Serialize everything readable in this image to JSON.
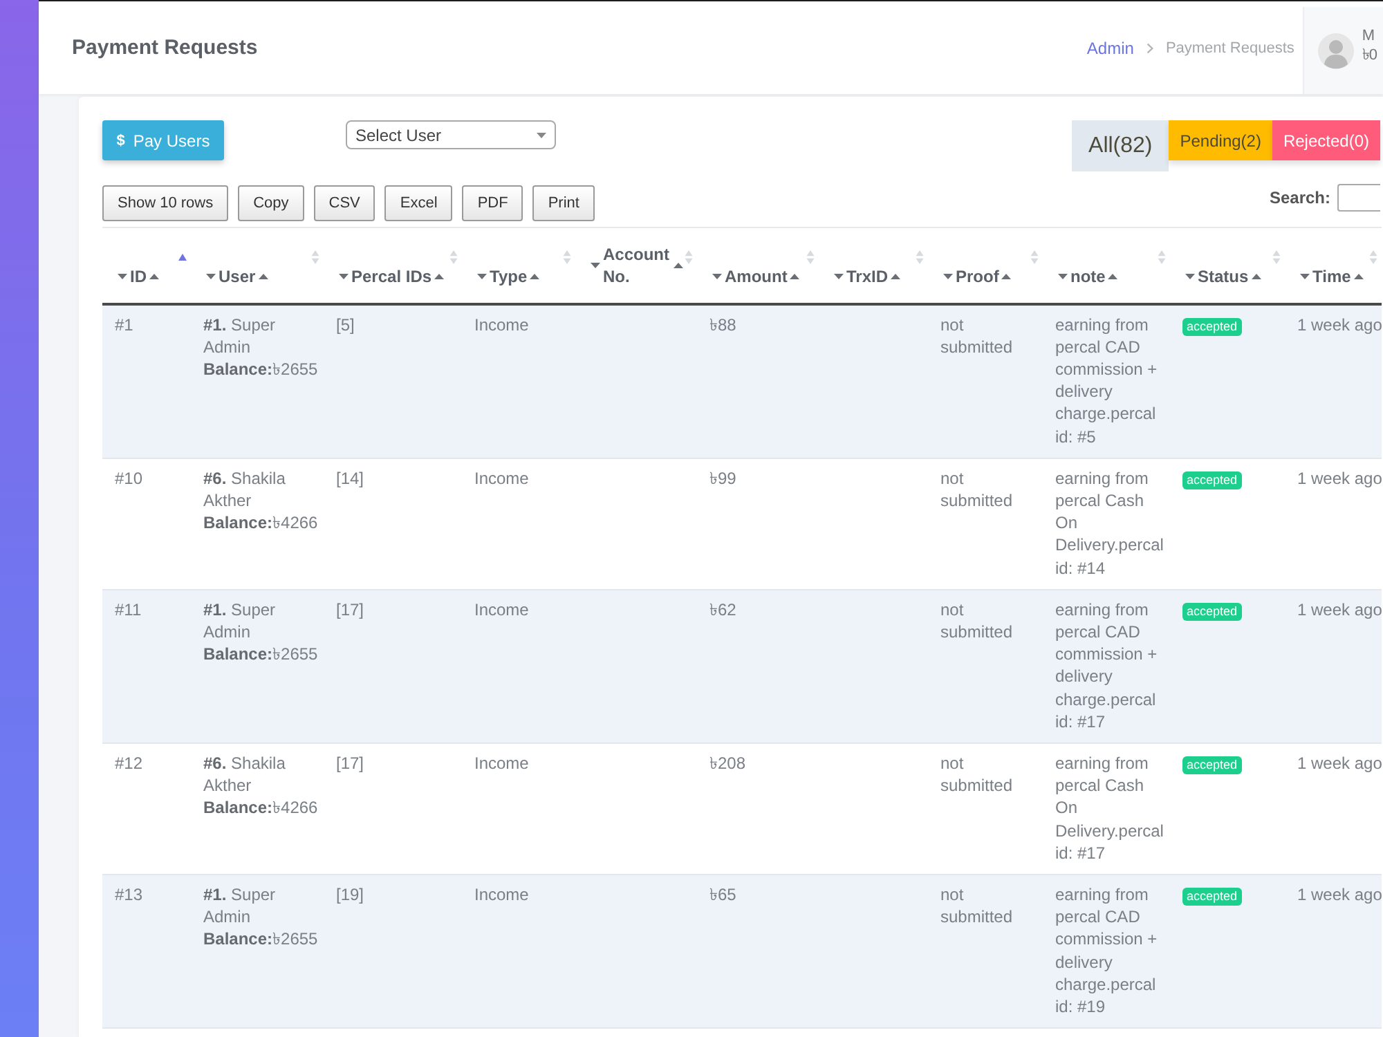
{
  "header": {
    "title": "Payment Requests",
    "breadcrumb": [
      {
        "label": "Admin",
        "link": true
      },
      {
        "label": "Payment Requests",
        "link": false
      }
    ],
    "user": {
      "name": "M",
      "balance": "৳0"
    }
  },
  "toolbar": {
    "pay_button": {
      "icon": "$",
      "label": "Pay Users"
    },
    "user_select": {
      "placeholder": "Select User"
    },
    "filter_tabs": [
      {
        "label": "All(82)",
        "selected": true,
        "color": "#e2e8f0"
      },
      {
        "label": "Pending(2)",
        "selected": false,
        "color": "#ffbb00"
      },
      {
        "label": "Rejected(0)",
        "selected": false,
        "color": "#ff5b7b"
      }
    ]
  },
  "export_buttons": [
    "Show 10 rows",
    "Copy",
    "CSV",
    "Excel",
    "PDF",
    "Print"
  ],
  "search": {
    "label": "Search:"
  },
  "table": {
    "columns": [
      {
        "label": "ID",
        "sorted": true
      },
      {
        "label": "User",
        "sorted": false
      },
      {
        "label": "Percal IDs",
        "sorted": false
      },
      {
        "label": "Type",
        "sorted": false
      },
      {
        "label": "Account No.",
        "sorted": false
      },
      {
        "label": "Amount",
        "sorted": false
      },
      {
        "label": "TrxID",
        "sorted": false
      },
      {
        "label": "Proof",
        "sorted": false
      },
      {
        "label": "note",
        "sorted": false
      },
      {
        "label": "Status",
        "sorted": false
      },
      {
        "label": "Time",
        "sorted": false
      }
    ],
    "rows": [
      {
        "id": "#1",
        "user": "**#1.** Super Admin",
        "balance": "**Balance:**৳2655",
        "percal_ids": "[5]",
        "type": "Income",
        "amount": "৳88",
        "proof": "not submitted",
        "note": "earning from percal CAD commission + delivery charge.percal id: #5",
        "status": "accepted",
        "time": "1 week ago"
      },
      {
        "id": "#10",
        "user": "**#6.** Shakila Akther",
        "balance": "**Balance:**৳4266",
        "percal_ids": "[14]",
        "type": "Income",
        "amount": "৳99",
        "proof": "not submitted",
        "note": "earning from percal Cash On Delivery.percal id: #14",
        "status": "accepted",
        "time": "1 week ago"
      },
      {
        "id": "#11",
        "user": "**#1.** Super Admin",
        "balance": "**Balance:**৳2655",
        "percal_ids": "[17]",
        "type": "Income",
        "amount": "৳62",
        "proof": "not submitted",
        "note": "earning from percal CAD commission + delivery charge.percal id: #17",
        "status": "accepted",
        "time": "1 week ago"
      },
      {
        "id": "#12",
        "user": "**#6.** Shakila Akther",
        "balance": "**Balance:**৳4266",
        "percal_ids": "[17]",
        "type": "Income",
        "amount": "৳208",
        "proof": "not submitted",
        "note": "earning from percal Cash On Delivery.percal id: #17",
        "status": "accepted",
        "time": "1 week ago"
      },
      {
        "id": "#13",
        "user": "**#1.** Super Admin",
        "balance": "**Balance:**৳2655",
        "percal_ids": "[19]",
        "type": "Income",
        "amount": "৳65",
        "proof": "not submitted",
        "note": "earning from percal CAD commission + delivery charge.percal id: #19",
        "status": "accepted",
        "time": "1 week ago"
      }
    ]
  }
}
